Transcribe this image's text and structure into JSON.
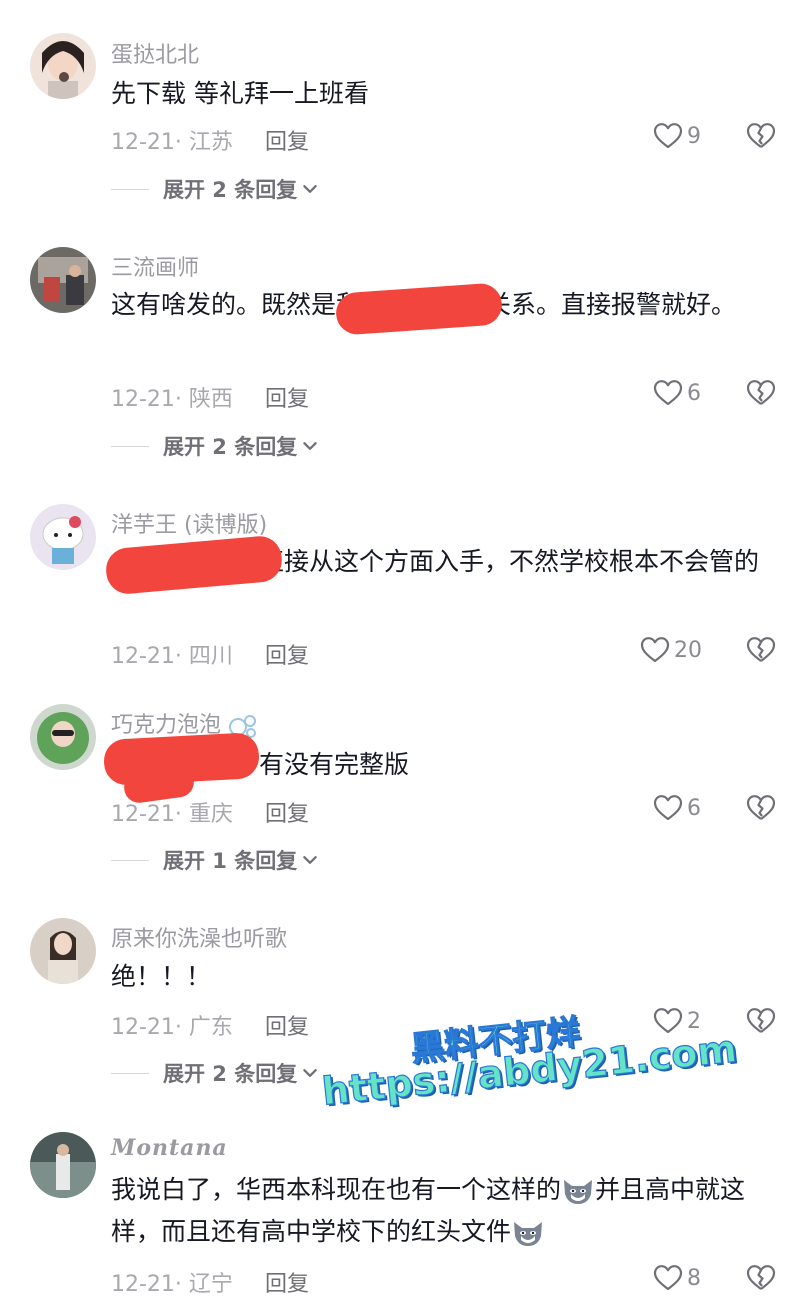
{
  "comments": [
    {
      "username": "蛋挞北北",
      "text": "先下载 等礼拜一上班看",
      "meta": "12-21· 江苏",
      "reply": "回复",
      "likes": "9",
      "expand": "展开 2 条回复"
    },
    {
      "username": "三流画师",
      "text": "这有啥发的。既然是和专业老师主关系。直接报警就好。",
      "meta": "12-21· 陕西",
      "reply": "回复",
      "likes": "6",
      "expand": "展开 2 条回复"
    },
    {
      "username": "洋芋王 (读博版)",
      "text_visible": "直接从这个方面入手，不然学校根本不会管的",
      "meta": "12-21· 四川",
      "reply": "回复",
      "likes": "20"
    },
    {
      "username": "巧克力泡泡",
      "text_visible": "有没有完整版",
      "meta": "12-21· 重庆",
      "reply": "回复",
      "likes": "6",
      "expand": "展开 1 条回复"
    },
    {
      "username": "原来你洗澡也听歌",
      "text": "绝！！！",
      "meta": "12-21· 广东",
      "reply": "回复",
      "likes": "2",
      "expand": "展开 2 条回复"
    },
    {
      "username": "Montana",
      "text_part1": "我说白了，华西本科现在也有一个这样的",
      "text_part2": "并且高中就这样，而且还有高中学校下的红头文件",
      "meta": "12-21· 辽宁",
      "reply": "回复",
      "likes": "8"
    }
  ],
  "watermark": {
    "line1": "黑料不打烊",
    "line2": "https://abdy21.com"
  },
  "colors": {
    "redaction": "#f2453d",
    "text": "#161823",
    "meta": "#a8a8ae",
    "watermark_fill": "#64e3c6",
    "watermark_stroke": "#2a78d6"
  }
}
